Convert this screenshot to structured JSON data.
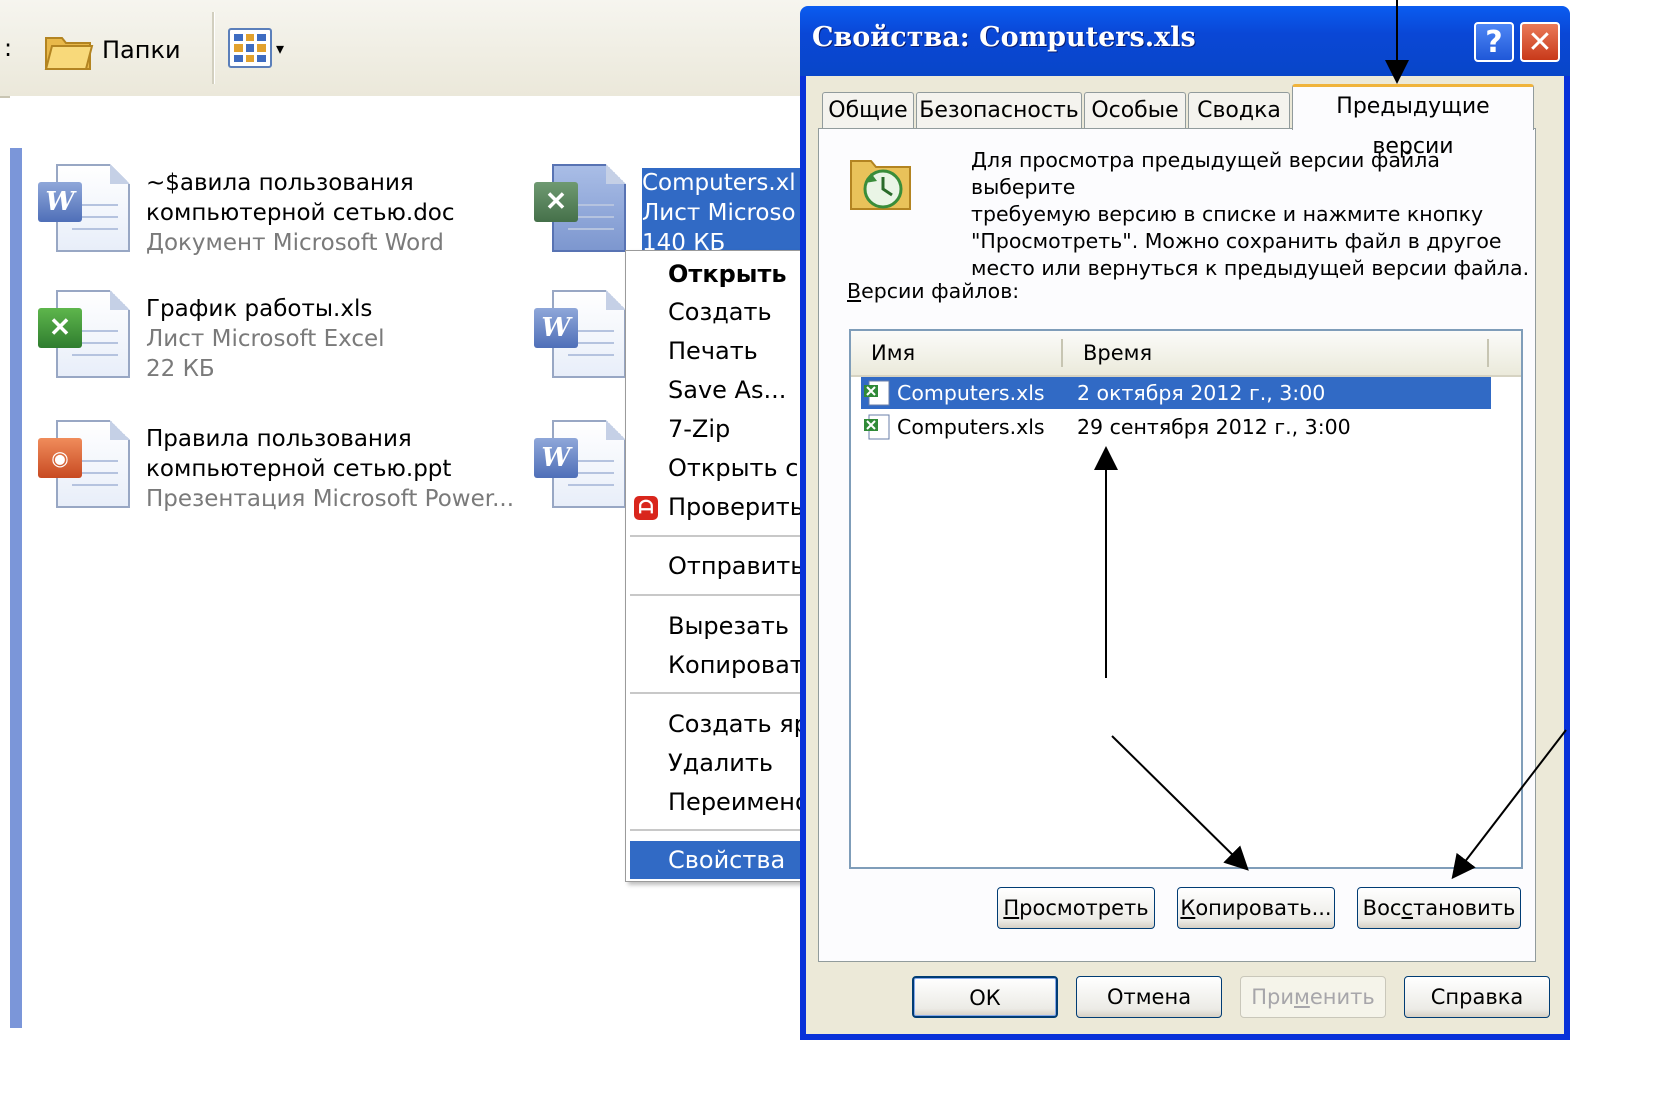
{
  "explorer": {
    "toolbar": {
      "colon": ":",
      "folders_label": "Папки",
      "views_icon": "views-grid-icon"
    },
    "files": [
      {
        "icon": "word-doc-icon",
        "line1": "~$авила пользования",
        "line2": "компьютерной сетью.doc",
        "line3": "Документ Microsoft Word"
      },
      {
        "icon": "excel-xls-icon",
        "line1": "Computers.xl",
        "line2": "Лист Microso",
        "line3": "140 КБ"
      },
      {
        "icon": "excel-xls-icon",
        "line1": "График работы.xls",
        "line2": "Лист Microsoft Excel",
        "line3": "22 КБ"
      },
      {
        "icon": "word-doc-icon"
      },
      {
        "icon": "powerpoint-ppt-icon",
        "line1": "Правила пользования",
        "line2": "компьютерной сетью.ppt",
        "line3": "Презентация Microsoft Power..."
      },
      {
        "icon": "word-doc-icon"
      }
    ]
  },
  "context_menu": {
    "items": [
      "Открыть",
      "Создать",
      "Печать",
      "Save As...",
      "7-Zip",
      "Открыть с",
      "Проверить",
      "Отправить",
      "Вырезать",
      "Копировать",
      "Создать яр",
      "Удалить",
      "Переименов",
      "Свойства"
    ],
    "active": "Свойства"
  },
  "dialog": {
    "title": "Свойства: Computers.xls",
    "help_button": "?",
    "close_button": "✕",
    "tabs": [
      "Общие",
      "Безопасность",
      "Особые",
      "Сводка",
      "Предыдущие версии"
    ],
    "active_tab": "Предыдущие версии",
    "info_lines": [
      "Для просмотра предыдущей версии файла выберите",
      "требуемую версию в списке и нажмите кнопку",
      "\"Просмотреть\".  Можно сохранить файл в другое",
      "место или вернуться к предыдущей версии файла."
    ],
    "versions_label_key": "В",
    "versions_label_rest": "ерсии файлов:",
    "list": {
      "headers": {
        "name": "Имя",
        "time": "Время"
      },
      "rows": [
        {
          "name": "Computers.xls",
          "time": "2 октября 2012 г., 3:00",
          "selected": true
        },
        {
          "name": "Computers.xls",
          "time": "29 сентября 2012 г., 3:00",
          "selected": false
        }
      ]
    },
    "actions": {
      "view": {
        "key": "П",
        "rest": "росмотреть"
      },
      "copy": {
        "key": "К",
        "rest": "опировать..."
      },
      "restore": {
        "pre": "Вос",
        "key": "с",
        "rest": "тановить"
      }
    },
    "footer": {
      "ok": "ОК",
      "cancel": "Отмена",
      "apply": {
        "pre": "При",
        "key": "м",
        "rest": "енить"
      },
      "help": "Справка"
    }
  }
}
